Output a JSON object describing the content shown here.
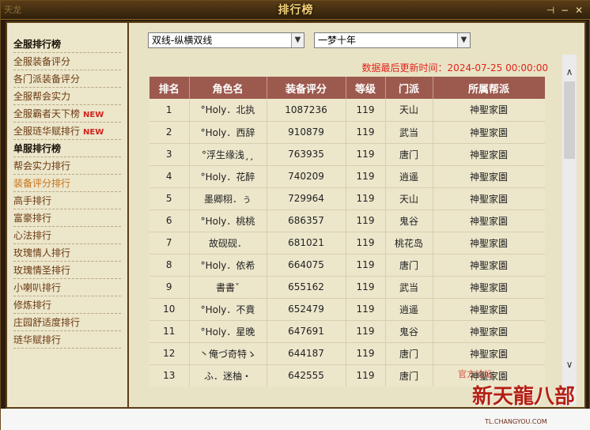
{
  "window": {
    "title": "排行榜",
    "logo_text": "天龙",
    "buttons": {
      "pin": "⊣",
      "minimize": "−",
      "close": "✕"
    }
  },
  "sidebar": {
    "items": [
      {
        "label": "全服排行榜",
        "type": "header"
      },
      {
        "label": "全服装备评分",
        "type": "item"
      },
      {
        "label": "各门派装备评分",
        "type": "item"
      },
      {
        "label": "全服帮会实力",
        "type": "item"
      },
      {
        "label": "全服霸者天下榜",
        "type": "item",
        "badge": "NEW"
      },
      {
        "label": "全服琏华赋排行",
        "type": "item",
        "badge": "NEW"
      },
      {
        "label": "单服排行榜",
        "type": "header"
      },
      {
        "label": "帮会实力排行",
        "type": "item"
      },
      {
        "label": "装备评分排行",
        "type": "item",
        "active": true
      },
      {
        "label": "高手排行",
        "type": "item"
      },
      {
        "label": "富豪排行",
        "type": "item"
      },
      {
        "label": "心法排行",
        "type": "item"
      },
      {
        "label": "玫瑰情人排行",
        "type": "item"
      },
      {
        "label": "玫瑰情圣排行",
        "type": "item"
      },
      {
        "label": "小喇叭排行",
        "type": "item"
      },
      {
        "label": "修炼排行",
        "type": "item"
      },
      {
        "label": "庄园舒适度排行",
        "type": "item"
      },
      {
        "label": "琏华赋排行",
        "type": "item"
      }
    ]
  },
  "filters": {
    "server_select": "双线-纵横双线",
    "realm_select": "一梦十年"
  },
  "updated_text": "数据最后更新时间：2024-07-25 00:00:00",
  "table": {
    "headers": [
      "排名",
      "角色名",
      "装备评分",
      "等级",
      "门派",
      "所属帮派"
    ],
    "rows": [
      [
        "1",
        "°Holy．北执",
        "1087236",
        "119",
        "天山",
        "神聖家園"
      ],
      [
        "2",
        "°Holy．西辞",
        "910879",
        "119",
        "武当",
        "神聖家園"
      ],
      [
        "3",
        "°浮生缘浅¸¸",
        "763935",
        "119",
        "唐门",
        "神聖家園"
      ],
      [
        "4",
        "°Holy．花醉",
        "740209",
        "119",
        "逍遥",
        "神聖家園"
      ],
      [
        "5",
        "墨卿栩．ぅ",
        "729964",
        "119",
        "天山",
        "神聖家園"
      ],
      [
        "6",
        "°Holy．桃桃",
        "686357",
        "119",
        "鬼谷",
        "神聖家園"
      ],
      [
        "7",
        "故砚砚．",
        "681021",
        "119",
        "桃花岛",
        "神聖家園"
      ],
      [
        "8",
        "°Holy．依希",
        "664075",
        "119",
        "唐门",
        "神聖家園"
      ],
      [
        "9",
        "書書ˇ",
        "655162",
        "119",
        "武当",
        "神聖家園"
      ],
      [
        "10",
        "°Holy．不賁",
        "652479",
        "119",
        "逍遥",
        "神聖家園"
      ],
      [
        "11",
        "°Holy．星晚",
        "647691",
        "119",
        "鬼谷",
        "神聖家園"
      ],
      [
        "12",
        "丶俺づ奇特ゝ",
        "644187",
        "119",
        "唐门",
        "神聖家園"
      ],
      [
        "13",
        "ふ．迷柚・",
        "642555",
        "119",
        "唐门",
        "神聖家園"
      ]
    ]
  },
  "scrollbar": {
    "up": "∧",
    "down": "∨",
    "position_fraction": 0.0
  },
  "watermark": {
    "top": "官方论坛",
    "main": "新天龍八部",
    "sub": "TL.CHANGYOU.COM"
  },
  "colors": {
    "title_text": "#f5d37a",
    "header_bg": "#9c5a4e",
    "update_text": "#e0241a",
    "active_item": "#c6731a",
    "new_badge": "#d0241a"
  }
}
